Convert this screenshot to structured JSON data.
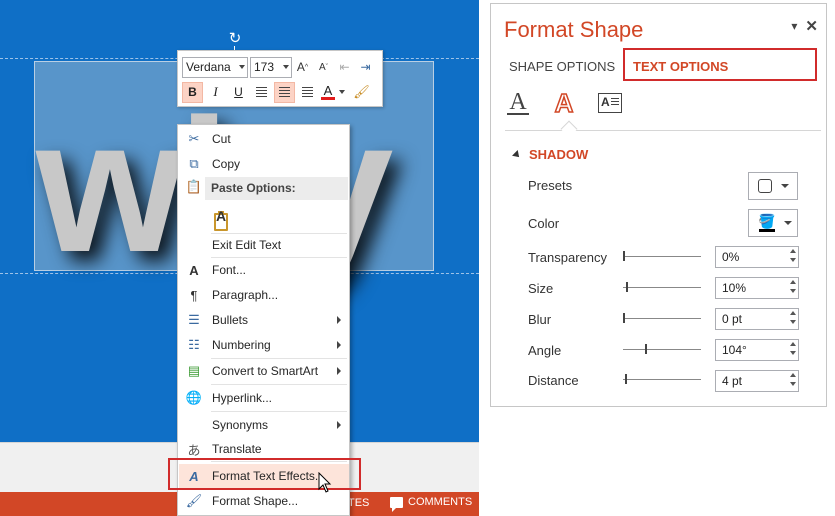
{
  "slide": {
    "big_text": "why",
    "status_notes": "TES",
    "status_comments": "COMMENTS"
  },
  "mini_toolbar": {
    "font_name": "Verdana",
    "font_size": "173"
  },
  "context_menu": {
    "items": [
      {
        "label": "Cut",
        "icon": "scissors-icon",
        "submenu": false
      },
      {
        "label": "Copy",
        "icon": "copy-icon",
        "submenu": false
      },
      {
        "label": "Paste Options:",
        "icon": "paste-icon",
        "submenu": false
      },
      {
        "label": "Exit Edit Text",
        "icon": "",
        "submenu": false
      },
      {
        "label": "Font...",
        "icon": "font-icon",
        "submenu": false
      },
      {
        "label": "Paragraph...",
        "icon": "paragraph-icon",
        "submenu": false
      },
      {
        "label": "Bullets",
        "icon": "bullets-icon",
        "submenu": true
      },
      {
        "label": "Numbering",
        "icon": "numbering-icon",
        "submenu": true
      },
      {
        "label": "Convert to SmartArt",
        "icon": "smartart-icon",
        "submenu": true
      },
      {
        "label": "Hyperlink...",
        "icon": "hyperlink-icon",
        "submenu": false
      },
      {
        "label": "Synonyms",
        "icon": "",
        "submenu": true
      },
      {
        "label": "Translate",
        "icon": "translate-icon",
        "submenu": false
      },
      {
        "label": "Format Text Effects...",
        "icon": "text-effects-icon",
        "submenu": false
      },
      {
        "label": "Format Shape...",
        "icon": "format-shape-icon",
        "submenu": false
      }
    ]
  },
  "pane": {
    "title": "Format Shape",
    "tabs": {
      "shape": "SHAPE OPTIONS",
      "text": "TEXT OPTIONS"
    },
    "section": "SHADOW",
    "presets_label": "Presets",
    "color_label": "Color",
    "shadow_color": "#000000",
    "props": [
      {
        "label": "Transparency",
        "value": "0%",
        "level": 0
      },
      {
        "label": "Size",
        "value": "10%",
        "level": 0.04
      },
      {
        "label": "Blur",
        "value": "0 pt",
        "level": 0
      },
      {
        "label": "Angle",
        "value": "104°",
        "level": 0.29
      },
      {
        "label": "Distance",
        "value": "4 pt",
        "level": 0.02
      }
    ]
  },
  "colors": {
    "slide_bg": "#0f6fc6",
    "accent": "#d24726",
    "highlight_border": "#d12b2b"
  }
}
